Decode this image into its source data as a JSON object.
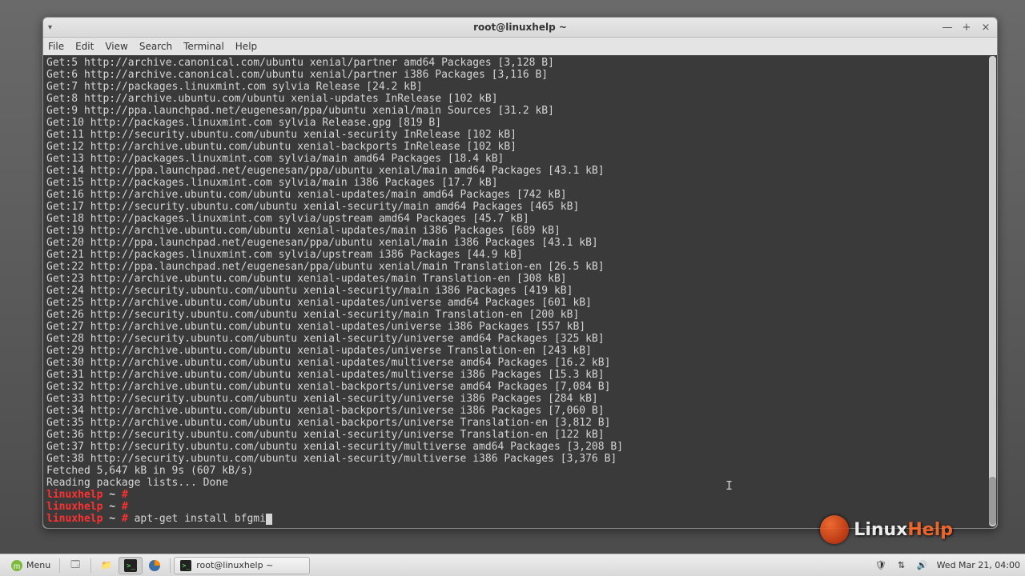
{
  "window": {
    "title": "root@linuxhelp ~",
    "controls": {
      "min": "—",
      "max": "+",
      "close": "×"
    }
  },
  "menubar": [
    "File",
    "Edit",
    "View",
    "Search",
    "Terminal",
    "Help"
  ],
  "output_lines": [
    "Get:5 http://archive.canonical.com/ubuntu xenial/partner amd64 Packages [3,128 B]",
    "Get:6 http://archive.canonical.com/ubuntu xenial/partner i386 Packages [3,116 B]",
    "Get:7 http://packages.linuxmint.com sylvia Release [24.2 kB]",
    "Get:8 http://archive.ubuntu.com/ubuntu xenial-updates InRelease [102 kB]",
    "Get:9 http://ppa.launchpad.net/eugenesan/ppa/ubuntu xenial/main Sources [31.2 kB]",
    "Get:10 http://packages.linuxmint.com sylvia Release.gpg [819 B]",
    "Get:11 http://security.ubuntu.com/ubuntu xenial-security InRelease [102 kB]",
    "Get:12 http://archive.ubuntu.com/ubuntu xenial-backports InRelease [102 kB]",
    "Get:13 http://packages.linuxmint.com sylvia/main amd64 Packages [18.4 kB]",
    "Get:14 http://ppa.launchpad.net/eugenesan/ppa/ubuntu xenial/main amd64 Packages [43.1 kB]",
    "Get:15 http://packages.linuxmint.com sylvia/main i386 Packages [17.7 kB]",
    "Get:16 http://archive.ubuntu.com/ubuntu xenial-updates/main amd64 Packages [742 kB]",
    "Get:17 http://security.ubuntu.com/ubuntu xenial-security/main amd64 Packages [465 kB]",
    "Get:18 http://packages.linuxmint.com sylvia/upstream amd64 Packages [45.7 kB]",
    "Get:19 http://archive.ubuntu.com/ubuntu xenial-updates/main i386 Packages [689 kB]",
    "Get:20 http://ppa.launchpad.net/eugenesan/ppa/ubuntu xenial/main i386 Packages [43.1 kB]",
    "Get:21 http://packages.linuxmint.com sylvia/upstream i386 Packages [44.9 kB]",
    "Get:22 http://ppa.launchpad.net/eugenesan/ppa/ubuntu xenial/main Translation-en [26.5 kB]",
    "Get:23 http://archive.ubuntu.com/ubuntu xenial-updates/main Translation-en [308 kB]",
    "Get:24 http://security.ubuntu.com/ubuntu xenial-security/main i386 Packages [419 kB]",
    "Get:25 http://archive.ubuntu.com/ubuntu xenial-updates/universe amd64 Packages [601 kB]",
    "Get:26 http://security.ubuntu.com/ubuntu xenial-security/main Translation-en [200 kB]",
    "Get:27 http://archive.ubuntu.com/ubuntu xenial-updates/universe i386 Packages [557 kB]",
    "Get:28 http://security.ubuntu.com/ubuntu xenial-security/universe amd64 Packages [325 kB]",
    "Get:29 http://archive.ubuntu.com/ubuntu xenial-updates/universe Translation-en [243 kB]",
    "Get:30 http://archive.ubuntu.com/ubuntu xenial-updates/multiverse amd64 Packages [16.2 kB]",
    "Get:31 http://archive.ubuntu.com/ubuntu xenial-updates/multiverse i386 Packages [15.3 kB]",
    "Get:32 http://archive.ubuntu.com/ubuntu xenial-backports/universe amd64 Packages [7,084 B]",
    "Get:33 http://security.ubuntu.com/ubuntu xenial-security/universe i386 Packages [284 kB]",
    "Get:34 http://archive.ubuntu.com/ubuntu xenial-backports/universe i386 Packages [7,060 B]",
    "Get:35 http://archive.ubuntu.com/ubuntu xenial-backports/universe Translation-en [3,812 B]",
    "Get:36 http://security.ubuntu.com/ubuntu xenial-security/universe Translation-en [122 kB]",
    "Get:37 http://security.ubuntu.com/ubuntu xenial-security/multiverse amd64 Packages [3,208 B]",
    "Get:38 http://security.ubuntu.com/ubuntu xenial-security/multiverse i386 Packages [3,376 B]",
    "Fetched 5,647 kB in 9s (607 kB/s)",
    "Reading package lists... Done"
  ],
  "prompt": {
    "host": "linuxhelp",
    "path": "~",
    "symbol": "#"
  },
  "empty_prompt_count": 2,
  "current_cmd": "apt-get install bfgmi",
  "taskbar": {
    "menu": "Menu",
    "task_title": "root@linuxhelp ~",
    "clock": "Wed Mar 21, 04:00"
  },
  "watermark": {
    "brand1": "Linux",
    "brand2": "Help"
  }
}
